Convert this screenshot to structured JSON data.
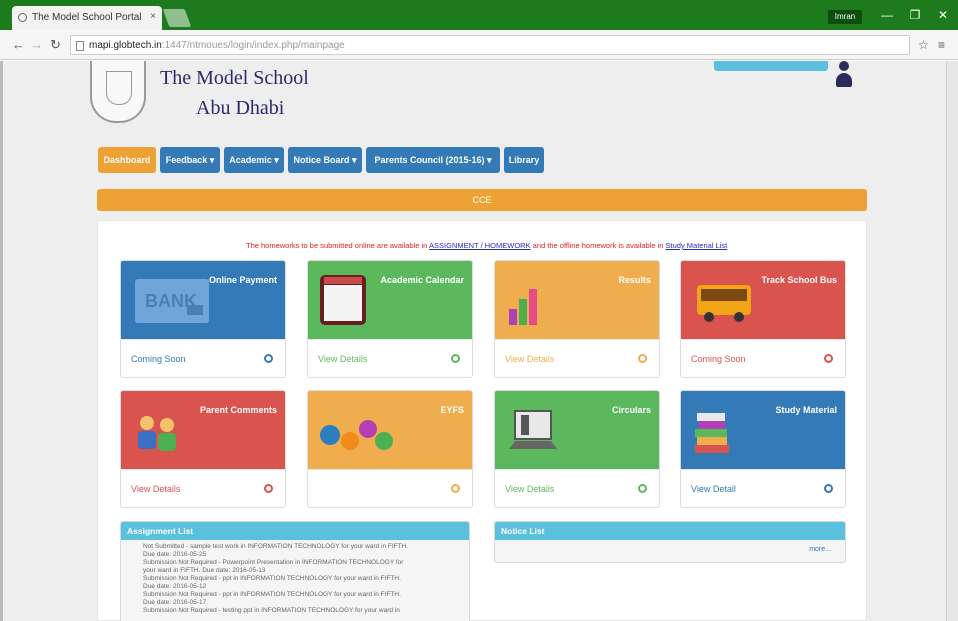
{
  "browser": {
    "tab_title": "The Model School Portal",
    "tab_close": "×",
    "user_chip": "Imran",
    "url_host": "mapi.globtech.in",
    "url_path": ":1447/ntmoues/login/index.php/mainpage",
    "window_buttons": [
      "—",
      "❐",
      "✕"
    ]
  },
  "header": {
    "school_name": "The Model School",
    "school_city": "Abu Dhabi"
  },
  "menu": [
    {
      "label": "Dashboard",
      "color": "#eea236"
    },
    {
      "label": "Feedback ▾",
      "color": "#337ab7"
    },
    {
      "label": "Academic ▾",
      "color": "#337ab7"
    },
    {
      "label": "Notice Board ▾",
      "color": "#337ab7"
    },
    {
      "label": "Parents Council (2015-16) ▾",
      "color": "#337ab7"
    },
    {
      "label": "Library",
      "color": "#337ab7"
    }
  ],
  "cce_label": "CCE",
  "notice": {
    "prefix": "The homeworks to be submitted online are available in",
    "link1": "ASSIGNMENT / HOMEWORK",
    "middle": "and the offline homework is available in",
    "link2": "Study Material List"
  },
  "cards": [
    {
      "title": "Online Payment",
      "link": "Coming Soon",
      "color": "#337ab7",
      "link_color": "#337ab7",
      "icon": "bank-card-icon"
    },
    {
      "title": "Academic Calendar",
      "link": "View Details",
      "color": "#5cb85c",
      "link_color": "#5cb85c",
      "icon": "calendar-icon"
    },
    {
      "title": "Results",
      "link": "View Details",
      "color": "#f0ad4e",
      "link_color": "#f0ad4e",
      "icon": "bar-chart-icon"
    },
    {
      "title": "Track School Bus",
      "link": "Coming Soon",
      "color": "#d9534f",
      "link_color": "#d9534f",
      "icon": "bus-icon"
    },
    {
      "title": "Parent Comments",
      "link": "View Details",
      "color": "#d9534f",
      "link_color": "#d9534f",
      "icon": "people-icon"
    },
    {
      "title": "EYFS",
      "link": "",
      "color": "#f0ad4e",
      "link_color": "#f0ad4e",
      "icon": "eyfs-icon"
    },
    {
      "title": "Circulars",
      "link": "View Details",
      "color": "#5cb85c",
      "link_color": "#5cb85c",
      "icon": "laptop-icon"
    },
    {
      "title": "Study Material",
      "link": "View Detail",
      "color": "#337ab7",
      "link_color": "#337ab7",
      "icon": "books-icon"
    }
  ],
  "assignment_list": {
    "title": "Assignment List",
    "items": [
      "Not Submitted - sample test work in INFORMATION TECHNOLOGY for your ward in FIFTH.",
      "Due date: 2016-05-25",
      "Submission Not Required - Powerpoint Presentation in INFORMATION TECHNOLOGY for",
      "your ward in FIFTH. Due date: 2016-05-13",
      "Submission Not Required - ppt in INFORMATION TECHNOLOGY for your ward in FIFTH.",
      "Due date: 2016-05-12",
      "Submission Not Required - ppt in INFORMATION TECHNOLOGY for your ward in FIFTH.",
      "Due date: 2016-05-17",
      "Submission Not Required - testing ppt in INFORMATION TECHNOLOGY for your ward in"
    ]
  },
  "notice_list": {
    "title": "Notice List",
    "more": "more..."
  }
}
